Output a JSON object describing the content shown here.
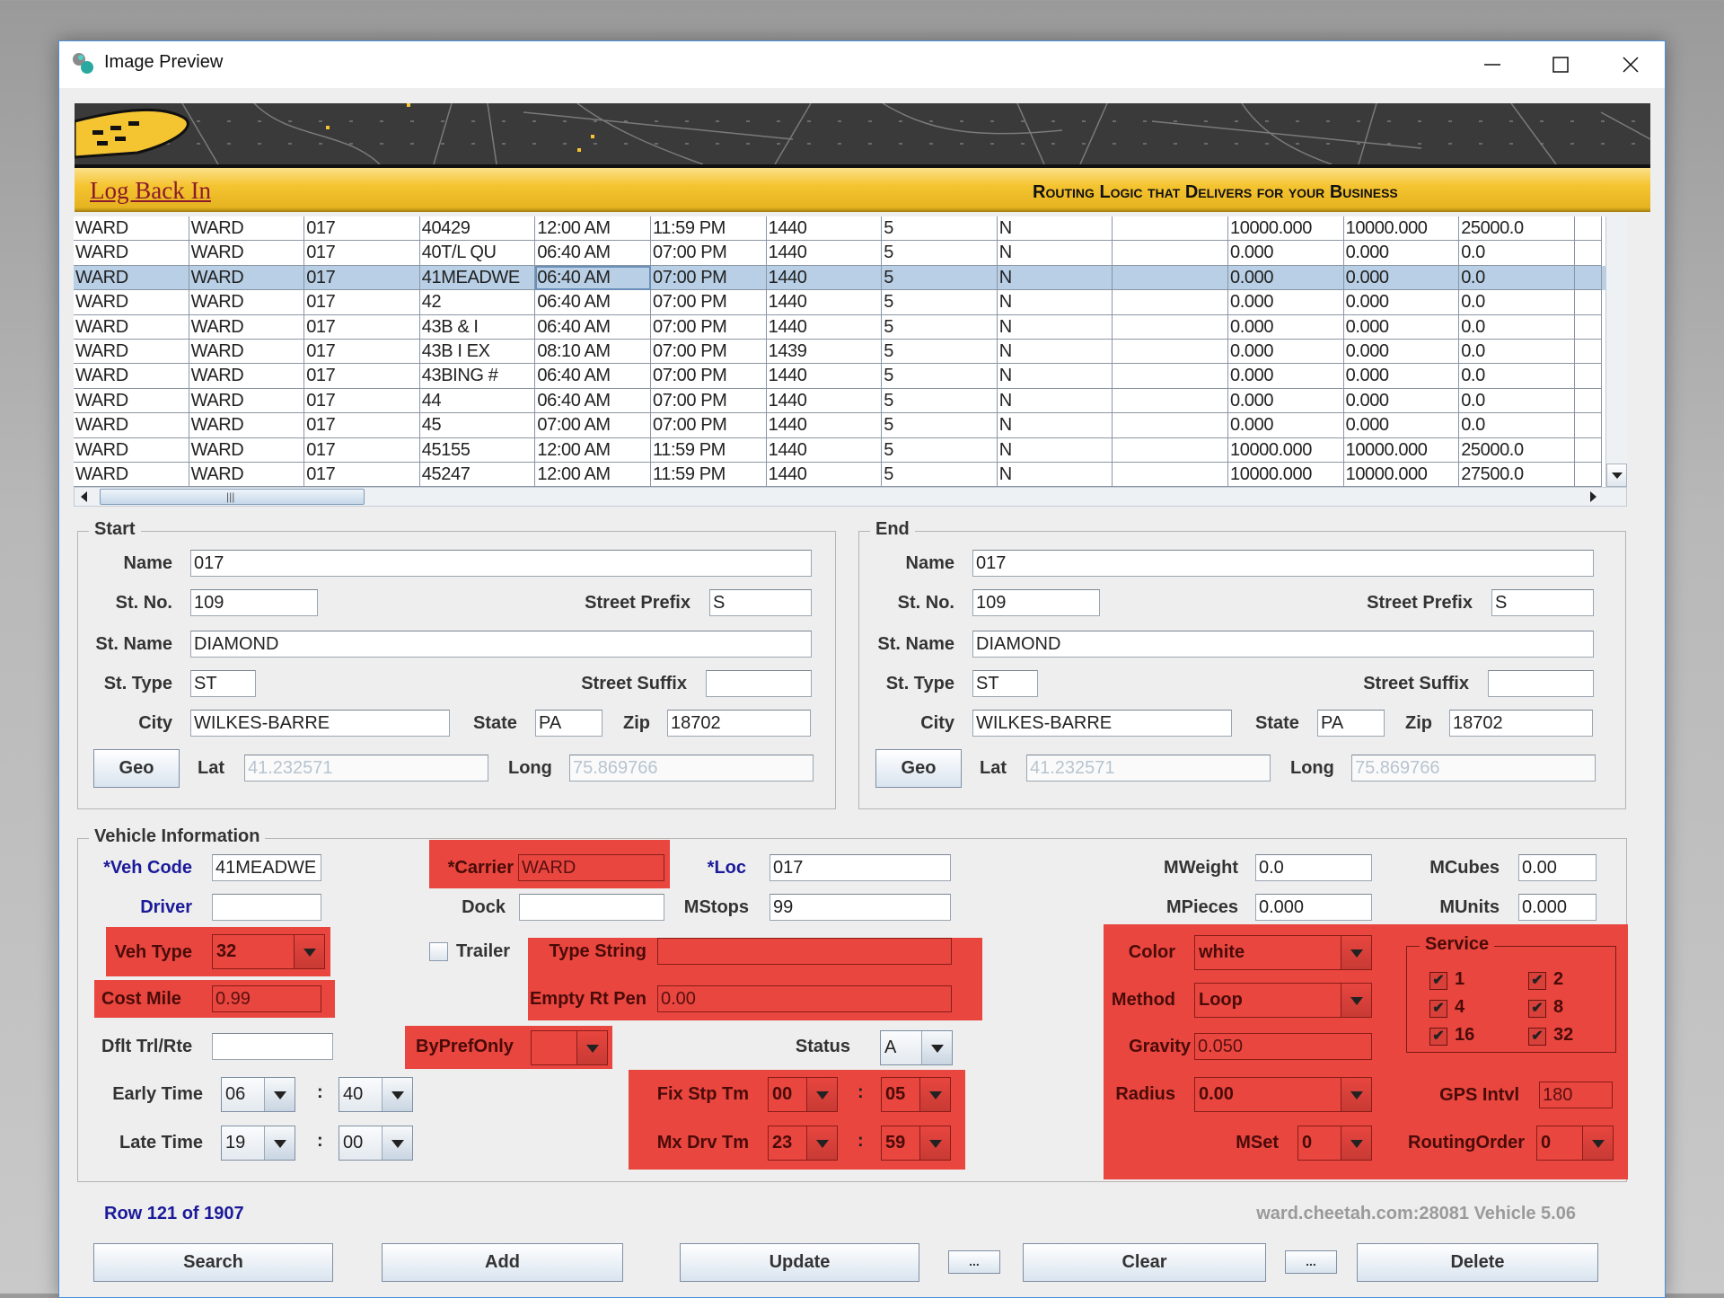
{
  "window": {
    "title": "Image Preview",
    "icon": "app-icon",
    "controls": [
      "minimize-icon",
      "maximize-icon",
      "close-icon"
    ]
  },
  "header": {
    "login_link": "Log Back In",
    "tagline": "Routing Logic that Delivers for your Business",
    "accent": "#f5c431"
  },
  "table": {
    "selected_row": 2,
    "rows": [
      [
        "WARD",
        "WARD",
        "017",
        "40429",
        "12:00 AM",
        "11:59 PM",
        "1440",
        "5",
        "N",
        "",
        "10000.000",
        "10000.000",
        "25000.0",
        ""
      ],
      [
        "WARD",
        "WARD",
        "017",
        "40T/L QU",
        "06:40 AM",
        "07:00 PM",
        "1440",
        "5",
        "N",
        "",
        "0.000",
        "0.000",
        "0.0",
        ""
      ],
      [
        "WARD",
        "WARD",
        "017",
        "41MEADWE",
        "06:40 AM",
        "07:00 PM",
        "1440",
        "5",
        "N",
        "",
        "0.000",
        "0.000",
        "0.0",
        ""
      ],
      [
        "WARD",
        "WARD",
        "017",
        "42",
        "06:40 AM",
        "07:00 PM",
        "1440",
        "5",
        "N",
        "",
        "0.000",
        "0.000",
        "0.0",
        ""
      ],
      [
        "WARD",
        "WARD",
        "017",
        "43B & I",
        "06:40 AM",
        "07:00 PM",
        "1440",
        "5",
        "N",
        "",
        "0.000",
        "0.000",
        "0.0",
        ""
      ],
      [
        "WARD",
        "WARD",
        "017",
        "43B I EX",
        "08:10 AM",
        "07:00 PM",
        "1439",
        "5",
        "N",
        "",
        "0.000",
        "0.000",
        "0.0",
        ""
      ],
      [
        "WARD",
        "WARD",
        "017",
        "43BING #",
        "06:40 AM",
        "07:00 PM",
        "1440",
        "5",
        "N",
        "",
        "0.000",
        "0.000",
        "0.0",
        ""
      ],
      [
        "WARD",
        "WARD",
        "017",
        "44",
        "06:40 AM",
        "07:00 PM",
        "1440",
        "5",
        "N",
        "",
        "0.000",
        "0.000",
        "0.0",
        ""
      ],
      [
        "WARD",
        "WARD",
        "017",
        "45",
        "07:00 AM",
        "07:00 PM",
        "1440",
        "5",
        "N",
        "",
        "0.000",
        "0.000",
        "0.0",
        ""
      ],
      [
        "WARD",
        "WARD",
        "017",
        "45155",
        "12:00 AM",
        "11:59 PM",
        "1440",
        "5",
        "N",
        "",
        "10000.000",
        "10000.000",
        "25000.0",
        ""
      ],
      [
        "WARD",
        "WARD",
        "017",
        "45247",
        "12:00 AM",
        "11:59 PM",
        "1440",
        "5",
        "N",
        "",
        "10000.000",
        "10000.000",
        "27500.0",
        ""
      ]
    ]
  },
  "start": {
    "title": "Start",
    "labels": {
      "name": "Name",
      "stno": "St. No.",
      "prefix": "Street Prefix",
      "stname": "St. Name",
      "sttype": "St. Type",
      "suffix": "Street Suffix",
      "city": "City",
      "state": "State",
      "zip": "Zip",
      "lat": "Lat",
      "long": "Long"
    },
    "geo": "Geo",
    "name": "017",
    "stno": "109",
    "prefix": "S",
    "stname": "DIAMOND",
    "sttype": "ST",
    "suffix": "",
    "city": "WILKES-BARRE",
    "state": "PA",
    "zip": "18702",
    "lat": "41.232571",
    "long": "75.869766"
  },
  "end": {
    "title": "End",
    "labels": {
      "name": "Name",
      "stno": "St. No.",
      "prefix": "Street Prefix",
      "stname": "St. Name",
      "sttype": "St. Type",
      "suffix": "Street Suffix",
      "city": "City",
      "state": "State",
      "zip": "Zip",
      "lat": "Lat",
      "long": "Long"
    },
    "geo": "Geo",
    "name": "017",
    "stno": "109",
    "prefix": "S",
    "stname": "DIAMOND",
    "sttype": "ST",
    "suffix": "",
    "city": "WILKES-BARRE",
    "state": "PA",
    "zip": "18702",
    "lat": "41.232571",
    "long": "75.869766"
  },
  "vehicle": {
    "title": "Vehicle Information",
    "veh_code_label": "*Veh Code",
    "veh_code": "41MEADWE",
    "carrier_label": "*Carrier",
    "carrier": "WARD",
    "loc_label": "*Loc",
    "loc": "017",
    "mweight_label": "MWeight",
    "mweight": "0.0",
    "mcubes_label": "MCubes",
    "mcubes": "0.00",
    "driver_label": "Driver",
    "driver": "",
    "dock_label": "Dock",
    "dock": "",
    "mstops_label": "MStops",
    "mstops": "99",
    "mpieces_label": "MPieces",
    "mpieces": "0.000",
    "munits_label": "MUnits",
    "munits": "0.000",
    "veh_type_label": "Veh Type",
    "veh_type": "32",
    "trailer_label": "Trailer",
    "trailer_checked": false,
    "type_string_label": "Type String",
    "type_string": "",
    "cost_mile_label": "Cost Mile",
    "cost_mile": "0.99",
    "empty_rt_pen_label": "Empty Rt Pen",
    "empty_rt_pen": "0.00",
    "dflt_label": "Dflt Trl/Rte",
    "dflt": "",
    "bypref_label": "ByPrefOnly",
    "bypref": "",
    "status_label": "Status",
    "status": "A",
    "early_label": "Early Time",
    "early_h": "06",
    "early_m": "40",
    "late_label": "Late Time",
    "late_h": "19",
    "late_m": "00",
    "colon": ":",
    "fix_label": "Fix Stp Tm",
    "fix_h": "00",
    "fix_m": "05",
    "mxdrv_label": "Mx Drv Tm",
    "mxdrv_h": "23",
    "mxdrv_m": "59",
    "color_label": "Color",
    "color": "white",
    "method_label": "Method",
    "method": "Loop",
    "gravity_label": "Gravity",
    "gravity": "0.050",
    "radius_label": "Radius",
    "radius": "0.00",
    "mset_label": "MSet",
    "mset": "0",
    "gps_label": "GPS Intvl",
    "gps": "180",
    "routing_label": "RoutingOrder",
    "routing": "0",
    "service_title": "Service",
    "service": [
      {
        "label": "1",
        "checked": true
      },
      {
        "label": "2",
        "checked": true
      },
      {
        "label": "4",
        "checked": true
      },
      {
        "label": "8",
        "checked": true
      },
      {
        "label": "16",
        "checked": true
      },
      {
        "label": "32",
        "checked": true
      }
    ],
    "highlight_color": "#e8463f"
  },
  "footer": {
    "row_status": "Row 121 of 1907",
    "server": "ward.cheetah.com:28081 Vehicle 5.06",
    "buttons": {
      "search": "Search",
      "add": "Add",
      "update": "Update",
      "more1": "...",
      "clear": "Clear",
      "more2": "...",
      "delete": "Delete"
    }
  }
}
